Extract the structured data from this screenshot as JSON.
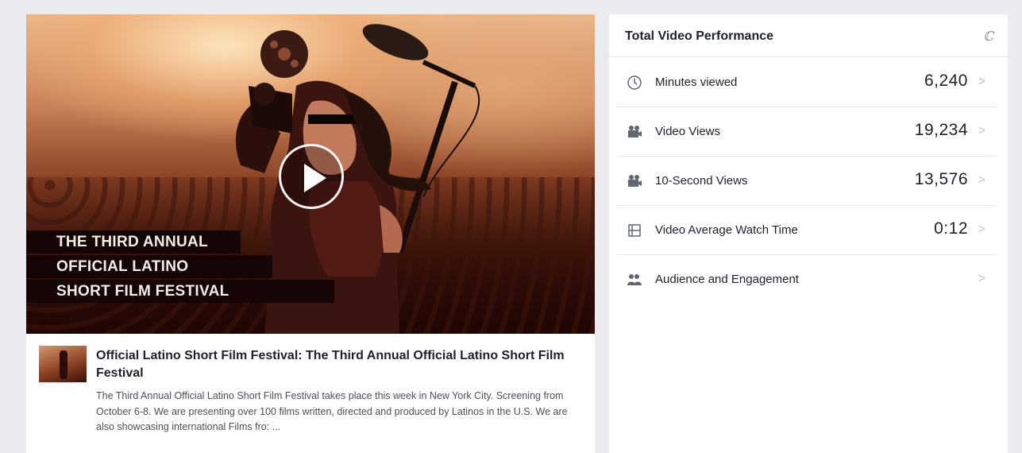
{
  "video": {
    "overlay_lines": [
      "THE THIRD ANNUAL",
      "OFFICIAL LATINO",
      "SHORT FILM FESTIVAL"
    ],
    "play_icon": "play-icon"
  },
  "post": {
    "title": "Official Latino Short Film Festival: The Third Annual Official Latino Short Film Festival",
    "description": "The Third Annual Official Latino Short Film Festival takes place this week in New York City. Screening from October 6-8. We are presenting over 100 films written, directed and produced by Latinos in the U.S. We are also showcasing international Films fro: ..."
  },
  "performance": {
    "title": "Total Video Performance",
    "info_icon": "info-icon",
    "metrics": [
      {
        "icon": "clock-icon",
        "label": "Minutes viewed",
        "value": "6,240",
        "chevron": ">"
      },
      {
        "icon": "video-camera-icon",
        "label": "Video Views",
        "value": "19,234",
        "chevron": ">"
      },
      {
        "icon": "video-camera-icon",
        "label": "10-Second Views",
        "value": "13,576",
        "chevron": ">"
      },
      {
        "icon": "film-frame-icon",
        "label": "Video Average Watch Time",
        "value": "0:12",
        "chevron": ">"
      },
      {
        "icon": "people-icon",
        "label": "Audience and Engagement",
        "value": "",
        "chevron": ">"
      }
    ]
  },
  "colors": {
    "background": "#e9ebee",
    "card": "#ffffff",
    "text": "#1d2129",
    "muted": "#90949c",
    "overlay_strip": "#150605"
  }
}
